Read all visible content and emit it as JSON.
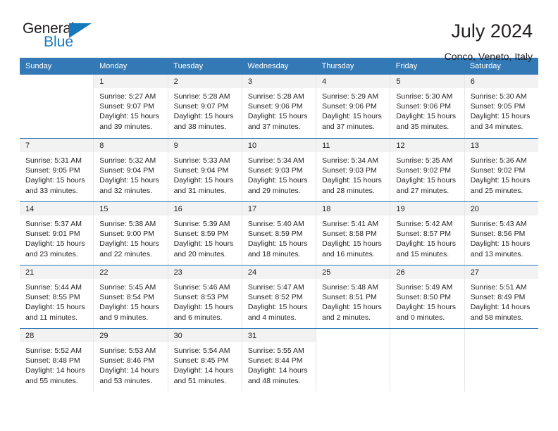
{
  "brand": {
    "name_part1": "General",
    "name_part2": "Blue",
    "triangle_color": "#1878be"
  },
  "header": {
    "title": "July 2024",
    "location": "Conco, Veneto, Italy"
  },
  "colors": {
    "header_row_bg": "#3379b5",
    "header_row_text": "#ffffff",
    "daynum_bg": "#f2f2f2",
    "text": "#231f20"
  },
  "weekday_headers": [
    "Sunday",
    "Monday",
    "Tuesday",
    "Wednesday",
    "Thursday",
    "Friday",
    "Saturday"
  ],
  "weeks": [
    [
      {
        "day": "",
        "sunrise": "",
        "sunset": "",
        "daylight_line1": "",
        "daylight_line2": ""
      },
      {
        "day": "1",
        "sunrise": "Sunrise: 5:27 AM",
        "sunset": "Sunset: 9:07 PM",
        "daylight_line1": "Daylight: 15 hours",
        "daylight_line2": "and 39 minutes."
      },
      {
        "day": "2",
        "sunrise": "Sunrise: 5:28 AM",
        "sunset": "Sunset: 9:07 PM",
        "daylight_line1": "Daylight: 15 hours",
        "daylight_line2": "and 38 minutes."
      },
      {
        "day": "3",
        "sunrise": "Sunrise: 5:28 AM",
        "sunset": "Sunset: 9:06 PM",
        "daylight_line1": "Daylight: 15 hours",
        "daylight_line2": "and 37 minutes."
      },
      {
        "day": "4",
        "sunrise": "Sunrise: 5:29 AM",
        "sunset": "Sunset: 9:06 PM",
        "daylight_line1": "Daylight: 15 hours",
        "daylight_line2": "and 37 minutes."
      },
      {
        "day": "5",
        "sunrise": "Sunrise: 5:30 AM",
        "sunset": "Sunset: 9:06 PM",
        "daylight_line1": "Daylight: 15 hours",
        "daylight_line2": "and 35 minutes."
      },
      {
        "day": "6",
        "sunrise": "Sunrise: 5:30 AM",
        "sunset": "Sunset: 9:05 PM",
        "daylight_line1": "Daylight: 15 hours",
        "daylight_line2": "and 34 minutes."
      }
    ],
    [
      {
        "day": "7",
        "sunrise": "Sunrise: 5:31 AM",
        "sunset": "Sunset: 9:05 PM",
        "daylight_line1": "Daylight: 15 hours",
        "daylight_line2": "and 33 minutes."
      },
      {
        "day": "8",
        "sunrise": "Sunrise: 5:32 AM",
        "sunset": "Sunset: 9:04 PM",
        "daylight_line1": "Daylight: 15 hours",
        "daylight_line2": "and 32 minutes."
      },
      {
        "day": "9",
        "sunrise": "Sunrise: 5:33 AM",
        "sunset": "Sunset: 9:04 PM",
        "daylight_line1": "Daylight: 15 hours",
        "daylight_line2": "and 31 minutes."
      },
      {
        "day": "10",
        "sunrise": "Sunrise: 5:34 AM",
        "sunset": "Sunset: 9:03 PM",
        "daylight_line1": "Daylight: 15 hours",
        "daylight_line2": "and 29 minutes."
      },
      {
        "day": "11",
        "sunrise": "Sunrise: 5:34 AM",
        "sunset": "Sunset: 9:03 PM",
        "daylight_line1": "Daylight: 15 hours",
        "daylight_line2": "and 28 minutes."
      },
      {
        "day": "12",
        "sunrise": "Sunrise: 5:35 AM",
        "sunset": "Sunset: 9:02 PM",
        "daylight_line1": "Daylight: 15 hours",
        "daylight_line2": "and 27 minutes."
      },
      {
        "day": "13",
        "sunrise": "Sunrise: 5:36 AM",
        "sunset": "Sunset: 9:02 PM",
        "daylight_line1": "Daylight: 15 hours",
        "daylight_line2": "and 25 minutes."
      }
    ],
    [
      {
        "day": "14",
        "sunrise": "Sunrise: 5:37 AM",
        "sunset": "Sunset: 9:01 PM",
        "daylight_line1": "Daylight: 15 hours",
        "daylight_line2": "and 23 minutes."
      },
      {
        "day": "15",
        "sunrise": "Sunrise: 5:38 AM",
        "sunset": "Sunset: 9:00 PM",
        "daylight_line1": "Daylight: 15 hours",
        "daylight_line2": "and 22 minutes."
      },
      {
        "day": "16",
        "sunrise": "Sunrise: 5:39 AM",
        "sunset": "Sunset: 8:59 PM",
        "daylight_line1": "Daylight: 15 hours",
        "daylight_line2": "and 20 minutes."
      },
      {
        "day": "17",
        "sunrise": "Sunrise: 5:40 AM",
        "sunset": "Sunset: 8:59 PM",
        "daylight_line1": "Daylight: 15 hours",
        "daylight_line2": "and 18 minutes."
      },
      {
        "day": "18",
        "sunrise": "Sunrise: 5:41 AM",
        "sunset": "Sunset: 8:58 PM",
        "daylight_line1": "Daylight: 15 hours",
        "daylight_line2": "and 16 minutes."
      },
      {
        "day": "19",
        "sunrise": "Sunrise: 5:42 AM",
        "sunset": "Sunset: 8:57 PM",
        "daylight_line1": "Daylight: 15 hours",
        "daylight_line2": "and 15 minutes."
      },
      {
        "day": "20",
        "sunrise": "Sunrise: 5:43 AM",
        "sunset": "Sunset: 8:56 PM",
        "daylight_line1": "Daylight: 15 hours",
        "daylight_line2": "and 13 minutes."
      }
    ],
    [
      {
        "day": "21",
        "sunrise": "Sunrise: 5:44 AM",
        "sunset": "Sunset: 8:55 PM",
        "daylight_line1": "Daylight: 15 hours",
        "daylight_line2": "and 11 minutes."
      },
      {
        "day": "22",
        "sunrise": "Sunrise: 5:45 AM",
        "sunset": "Sunset: 8:54 PM",
        "daylight_line1": "Daylight: 15 hours",
        "daylight_line2": "and 9 minutes."
      },
      {
        "day": "23",
        "sunrise": "Sunrise: 5:46 AM",
        "sunset": "Sunset: 8:53 PM",
        "daylight_line1": "Daylight: 15 hours",
        "daylight_line2": "and 6 minutes."
      },
      {
        "day": "24",
        "sunrise": "Sunrise: 5:47 AM",
        "sunset": "Sunset: 8:52 PM",
        "daylight_line1": "Daylight: 15 hours",
        "daylight_line2": "and 4 minutes."
      },
      {
        "day": "25",
        "sunrise": "Sunrise: 5:48 AM",
        "sunset": "Sunset: 8:51 PM",
        "daylight_line1": "Daylight: 15 hours",
        "daylight_line2": "and 2 minutes."
      },
      {
        "day": "26",
        "sunrise": "Sunrise: 5:49 AM",
        "sunset": "Sunset: 8:50 PM",
        "daylight_line1": "Daylight: 15 hours",
        "daylight_line2": "and 0 minutes."
      },
      {
        "day": "27",
        "sunrise": "Sunrise: 5:51 AM",
        "sunset": "Sunset: 8:49 PM",
        "daylight_line1": "Daylight: 14 hours",
        "daylight_line2": "and 58 minutes."
      }
    ],
    [
      {
        "day": "28",
        "sunrise": "Sunrise: 5:52 AM",
        "sunset": "Sunset: 8:48 PM",
        "daylight_line1": "Daylight: 14 hours",
        "daylight_line2": "and 55 minutes."
      },
      {
        "day": "29",
        "sunrise": "Sunrise: 5:53 AM",
        "sunset": "Sunset: 8:46 PM",
        "daylight_line1": "Daylight: 14 hours",
        "daylight_line2": "and 53 minutes."
      },
      {
        "day": "30",
        "sunrise": "Sunrise: 5:54 AM",
        "sunset": "Sunset: 8:45 PM",
        "daylight_line1": "Daylight: 14 hours",
        "daylight_line2": "and 51 minutes."
      },
      {
        "day": "31",
        "sunrise": "Sunrise: 5:55 AM",
        "sunset": "Sunset: 8:44 PM",
        "daylight_line1": "Daylight: 14 hours",
        "daylight_line2": "and 48 minutes."
      },
      {
        "day": "",
        "sunrise": "",
        "sunset": "",
        "daylight_line1": "",
        "daylight_line2": ""
      },
      {
        "day": "",
        "sunrise": "",
        "sunset": "",
        "daylight_line1": "",
        "daylight_line2": ""
      },
      {
        "day": "",
        "sunrise": "",
        "sunset": "",
        "daylight_line1": "",
        "daylight_line2": ""
      }
    ]
  ]
}
